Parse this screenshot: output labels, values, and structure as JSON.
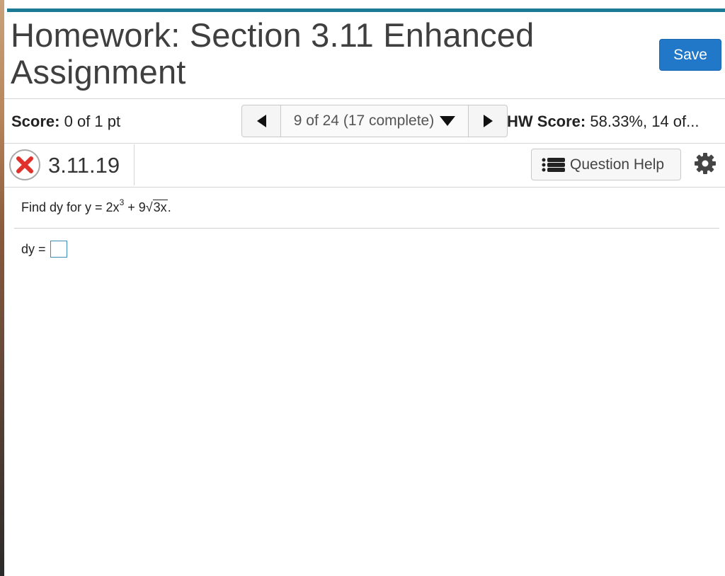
{
  "header": {
    "title": "Homework: Section 3.11 Enhanced Assignment",
    "save_label": "Save"
  },
  "score_bar": {
    "score_label": "Score:",
    "score_value": "0 of 1 pt",
    "nav_label": "9 of 24 (17 complete)",
    "hw_score_label": "HW Score:",
    "hw_score_value": "58.33%, 14 of..."
  },
  "question_header": {
    "number": "3.11.19",
    "status": "incorrect",
    "help_label": "Question Help"
  },
  "question": {
    "prompt_start": "Find dy for y = 2x",
    "exponent": "3",
    "middle": " + 9",
    "radicand": "3x",
    "end": ".",
    "answer_label": "dy ="
  },
  "colors": {
    "accent_bar": "#1b7a94",
    "save_button": "#2177c8",
    "incorrect_icon": "#e0312a"
  }
}
